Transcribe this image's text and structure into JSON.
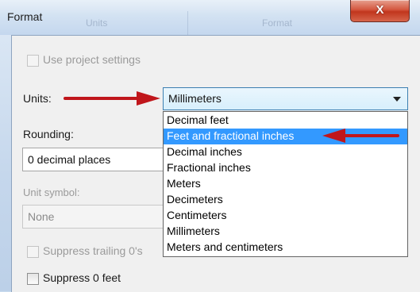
{
  "window": {
    "title": "Format",
    "close_glyph": "X",
    "ghost_tabs": [
      "Units",
      "Format"
    ]
  },
  "use_project_settings": {
    "label": "Use project settings",
    "checked": false,
    "enabled": false
  },
  "units": {
    "label": "Units:",
    "selected": "Millimeters",
    "options": [
      "Decimal feet",
      "Feet and fractional inches",
      "Decimal inches",
      "Fractional inches",
      "Meters",
      "Decimeters",
      "Centimeters",
      "Millimeters",
      "Meters and centimeters"
    ],
    "highlighted_option": "Feet and fractional inches"
  },
  "rounding": {
    "label": "Rounding:",
    "value": "0 decimal places"
  },
  "unit_symbol": {
    "label": "Unit symbol:",
    "value": "None",
    "enabled": false
  },
  "suppress_trailing": {
    "label": "Suppress trailing 0's",
    "checked": false,
    "enabled": false
  },
  "suppress_feet": {
    "label": "Suppress 0 feet",
    "checked": false,
    "enabled": true
  },
  "colors": {
    "annotation_arrow": "#c0161b",
    "selection": "#3399ff"
  },
  "icons": {
    "close": "close-icon",
    "dropdown": "chevron-down-icon",
    "arrow": "red-arrow-icon"
  }
}
